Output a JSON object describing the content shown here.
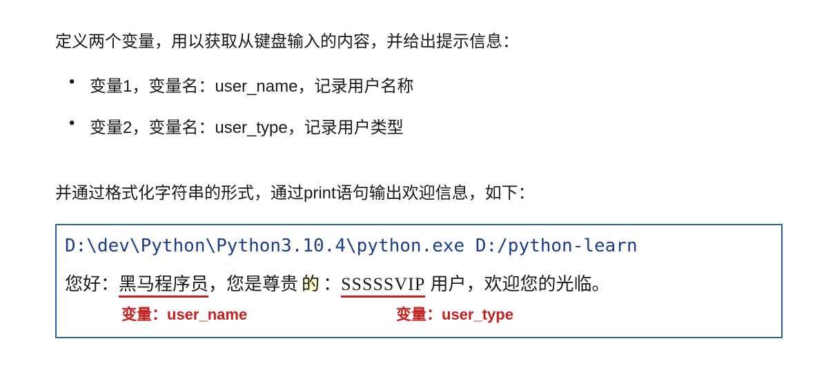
{
  "intro": "定义两个变量，用以获取从键盘输入的内容，并给出提示信息：",
  "bullets": [
    "变量1，变量名：user_name，记录用户名称",
    "变量2，变量名：user_type，记录用户类型"
  ],
  "second_paragraph": "并通过格式化字符串的形式，通过print语句输出欢迎信息，如下：",
  "code_box": {
    "path_line": "D:\\dev\\Python\\Python3.10.4\\python.exe D:/python-learn",
    "output_prefix": "您好：",
    "user_name_value": "黑马程序员",
    "output_mid1": "，您是尊贵",
    "output_mid_highlight": "的",
    "output_mid2": "：",
    "user_type_value": "SSSSSVIP",
    "output_suffix": " 用户，欢迎您的光临。"
  },
  "labels": {
    "label_1": "变量：user_name",
    "label_2": "变量：user_type"
  }
}
